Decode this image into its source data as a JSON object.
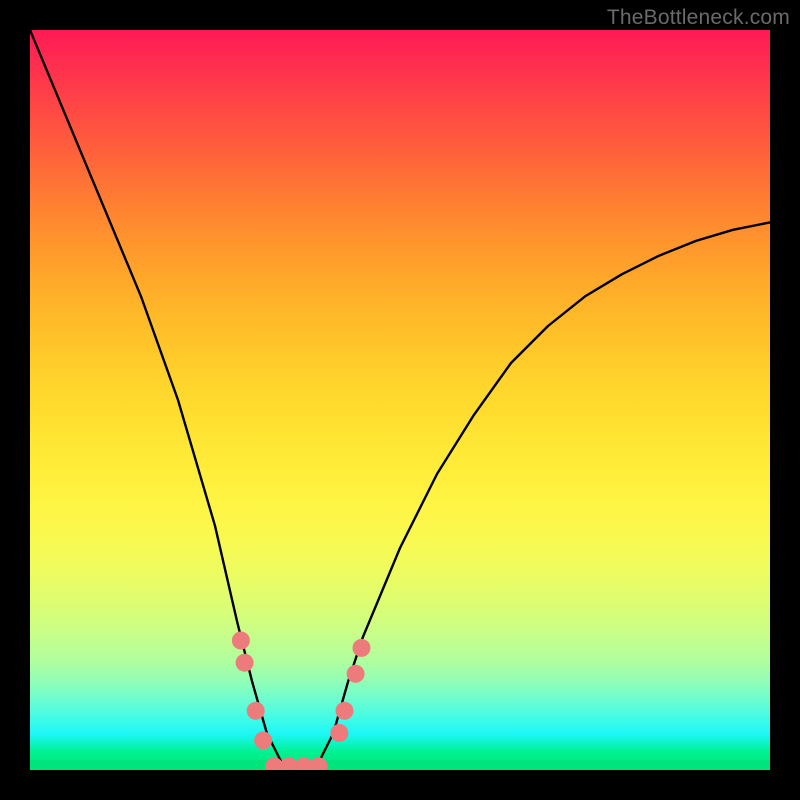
{
  "meta": {
    "watermark": "TheBottleneck.com"
  },
  "chart_data": {
    "type": "line",
    "title": "",
    "xlabel": "",
    "ylabel": "",
    "xlim": [
      0,
      100
    ],
    "ylim": [
      0,
      100
    ],
    "grid": false,
    "legend": false,
    "series": [
      {
        "name": "bottleneck-curve",
        "x": [
          0,
          5,
          10,
          15,
          20,
          25,
          28,
          30,
          32,
          34,
          35,
          37,
          39,
          41,
          43,
          45,
          50,
          55,
          60,
          65,
          70,
          75,
          80,
          85,
          90,
          95,
          100
        ],
        "values": [
          100,
          88,
          76,
          64,
          50,
          33,
          20,
          12,
          5,
          1,
          0,
          0,
          1,
          5,
          12,
          18,
          30,
          40,
          48,
          55,
          60,
          64,
          67,
          69.5,
          71.5,
          73,
          74
        ]
      }
    ],
    "markers": {
      "name": "highlight-dots",
      "color": "#ed7b7b",
      "radius_px": 9,
      "points": [
        {
          "x": 28.5,
          "y": 17.5
        },
        {
          "x": 29.0,
          "y": 14.5
        },
        {
          "x": 30.5,
          "y": 8.0
        },
        {
          "x": 31.5,
          "y": 4.0
        },
        {
          "x": 33.0,
          "y": 0.5
        },
        {
          "x": 35.0,
          "y": 0.5
        },
        {
          "x": 37.0,
          "y": 0.5
        },
        {
          "x": 39.0,
          "y": 0.5
        },
        {
          "x": 41.8,
          "y": 5.0
        },
        {
          "x": 42.5,
          "y": 8.0
        },
        {
          "x": 44.0,
          "y": 13.0
        },
        {
          "x": 44.8,
          "y": 16.5
        }
      ]
    },
    "background_bands_color_top_to_bottom": [
      "#ff1a55",
      "#ff2a50",
      "#ff3a4a",
      "#ff4a44",
      "#ff5a3e",
      "#ff6a38",
      "#ff7a33",
      "#ff8a2f",
      "#ff992c",
      "#ffa72a",
      "#ffb429",
      "#ffc029",
      "#ffcb2a",
      "#ffd52c",
      "#ffde2f",
      "#ffe634",
      "#ffed3a",
      "#fff341",
      "#fcf74a",
      "#f5fa55",
      "#eafc63",
      "#dbfd74",
      "#c8fe88",
      "#b0fe9e",
      "#92feb6",
      "#6ffdce",
      "#46fbe4",
      "#1cf7f6",
      "#00f191",
      "#00e878"
    ]
  }
}
